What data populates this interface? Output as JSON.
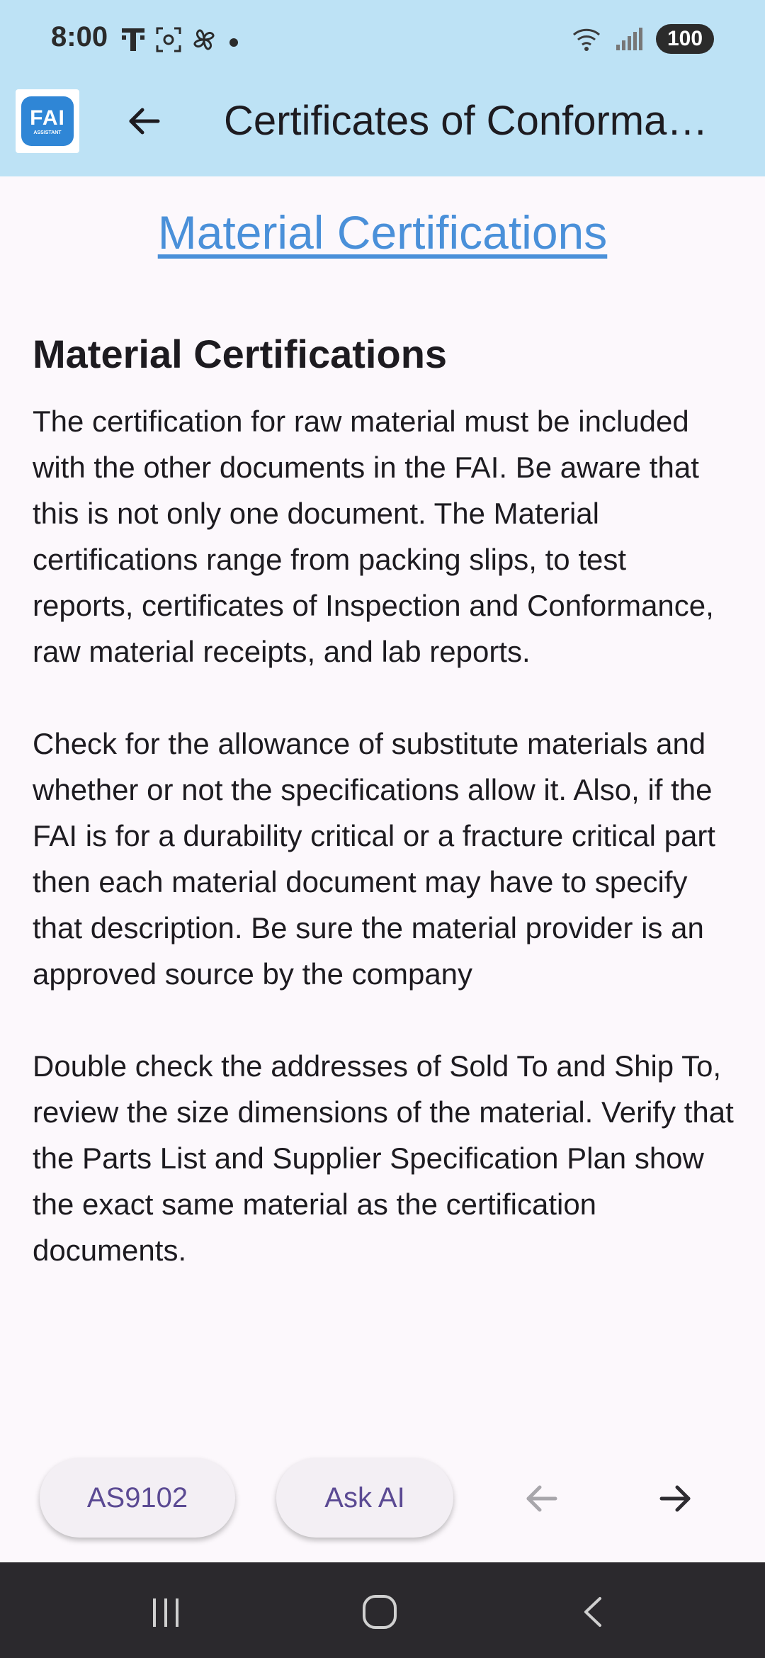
{
  "status_bar": {
    "time": "8:00",
    "battery": "100",
    "left_icons": [
      "t-mobile-icon",
      "screenshot-icon",
      "pinwheel-icon",
      "notification-dot"
    ],
    "right_icons": [
      "wifi-icon",
      "signal-icon"
    ]
  },
  "app_bar": {
    "logo_text": "FAI",
    "logo_subtext": "ASSISTANT",
    "title": "Certificates of Conformance",
    "back_icon": "arrow-left-icon"
  },
  "content": {
    "link": "Material Certifications",
    "heading": "Material Certifications",
    "paragraphs": [
      "The certification for raw material must be included with the other documents in the FAI. Be aware that this is not only one document. The Material certifications range from packing slips, to test reports, certificates of Inspection and Conformance, raw material receipts, and lab reports.",
      "Check for the allowance of substitute materials and whether or not the specifications allow it. Also, if the FAI is for a durability critical or a fracture critical part then each material document may have to specify that description. Be sure the material provider is an approved source by the company",
      "Double check the addresses of Sold To and Ship To, review the size dimensions of the material. Verify that the Parts List and Supplier Specification Plan show the exact same material as the certification documents."
    ]
  },
  "actions": {
    "as9102_label": "AS9102",
    "ask_ai_label": "Ask AI",
    "prev_icon": "arrow-left-icon",
    "next_icon": "arrow-right-icon"
  },
  "system_nav": {
    "icons": [
      "recents-icon",
      "home-icon",
      "back-icon"
    ]
  },
  "colors": {
    "app_bar": "#bde2f5",
    "link": "#4a90d9",
    "pill_text": "#5b4a93",
    "background": "#fcf8fc",
    "system_nav": "#2b292d"
  }
}
